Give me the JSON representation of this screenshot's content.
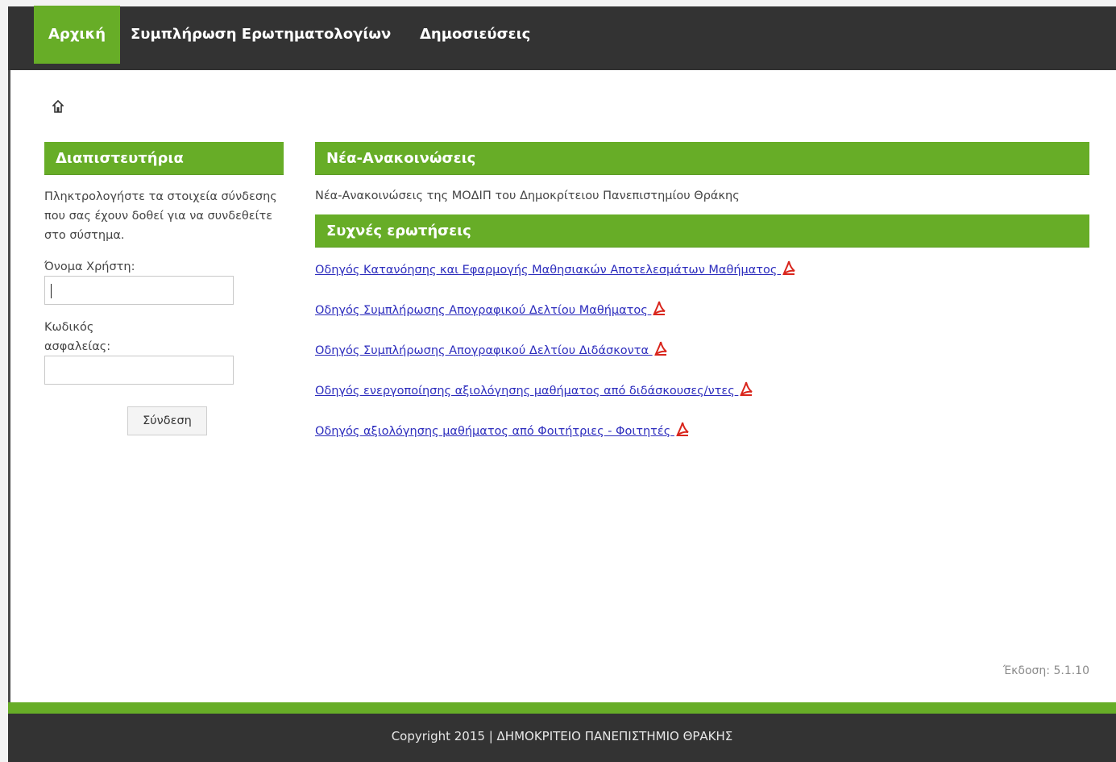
{
  "nav": {
    "items": [
      {
        "label": "Αρχική",
        "active": true
      },
      {
        "label": "Συμπλήρωση Ερωτηματολογίων",
        "active": false
      },
      {
        "label": "Δημοσιεύσεις",
        "active": false
      }
    ]
  },
  "breadcrumb": {
    "icon": "home-icon"
  },
  "login": {
    "title": "Διαπιστευτήρια",
    "instructions": "Πληκτρολογήστε τα στοιχεία σύνδεσης που σας έχουν δοθεί για να συνδεθείτε στο σύστημα.",
    "username_label": "Όνομα Χρήστη:",
    "username_value": "",
    "password_label": "Κωδικός ασφαλείας:",
    "password_value": "",
    "submit_label": "Σύνδεση"
  },
  "news": {
    "title": "Νέα-Ανακοινώσεις",
    "text": "Νέα-Ανακοινώσεις της ΜΟΔΙΠ του Δημοκρίτειου Πανεπιστημίου Θράκης"
  },
  "faq": {
    "title": "Συχνές ερωτήσεις",
    "links": [
      {
        "label": "Οδηγός Κατανόησης και Εφαρμογής Μαθησιακών Αποτελεσμάτων Μαθήματος",
        "icon": "pdf-icon"
      },
      {
        "label": "Οδηγός Συμπλήρωσης Απογραφικού Δελτίου Μαθήματος",
        "icon": "pdf-icon"
      },
      {
        "label": "Οδηγός Συμπλήρωσης Απογραφικού Δελτίου Διδάσκοντα",
        "icon": "pdf-icon"
      },
      {
        "label": "Οδηγός ενεργοποίησης αξιολόγησης μαθήματος από διδάσκουσες/ντες",
        "icon": "pdf-icon"
      },
      {
        "label": "Οδηγός αξιολόγησης μαθήματος από Φοιτήτριες - Φοιτητές",
        "icon": "pdf-icon"
      }
    ]
  },
  "version": "Έκδοση: 5.1.10",
  "footer": {
    "text": "Copyright 2015 | ΔΗΜΟΚΡΙΤΕΙΟ ΠΑΝΕΠΙΣΤΗΜΙΟ ΘΡΑΚΗΣ"
  },
  "colors": {
    "accent": "#67ad27",
    "dark": "#333333",
    "link": "#2c2cbd",
    "pdf": "#d9251c"
  }
}
